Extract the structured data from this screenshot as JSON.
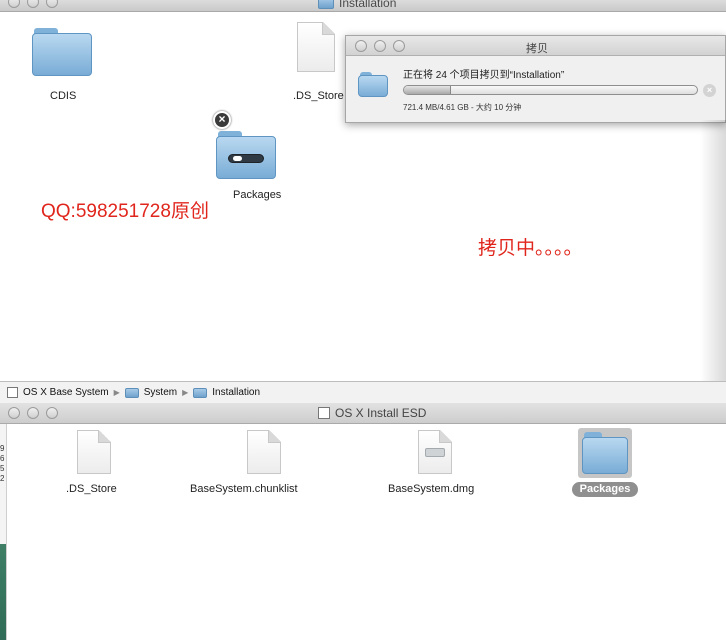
{
  "top_window": {
    "title": "Installation",
    "items": {
      "cdis": "CDIS",
      "ds_store": ".DS_Store",
      "packages": "Packages"
    },
    "watermark": "QQ:598251728原创",
    "copying_note": "拷贝中。。。。"
  },
  "copy_dialog": {
    "title": "拷贝",
    "status": "正在将 24 个项目拷贝到“Installation”",
    "size_info": "721.4 MB/4.61 GB - 大约 10 分钟",
    "progress_fraction": 0.16
  },
  "path_bar": {
    "items": [
      "OS X Base System",
      "System",
      "Installation"
    ]
  },
  "bottom_window": {
    "title": "OS X Install ESD",
    "items": [
      ".DS_Store",
      "BaseSystem.chunklist",
      "BaseSystem.dmg",
      "Packages"
    ],
    "edge_digits": [
      "9",
      "6",
      "5",
      "2"
    ]
  }
}
